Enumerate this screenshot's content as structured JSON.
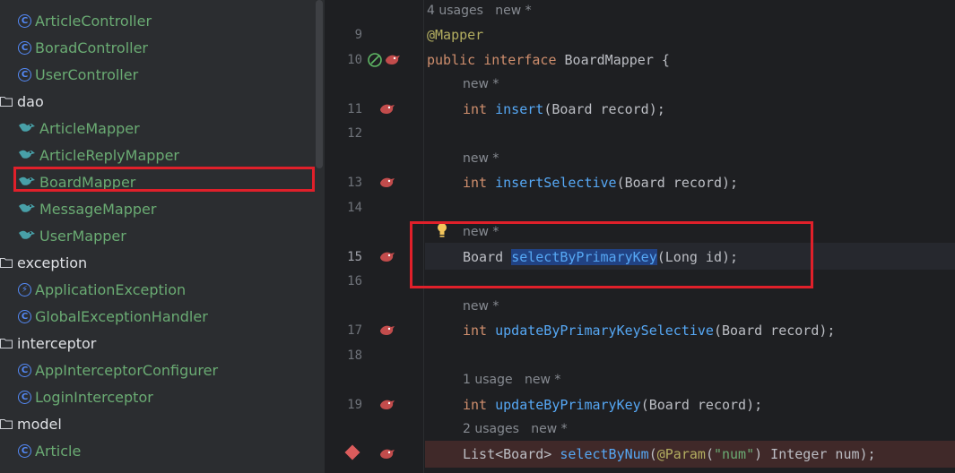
{
  "sidebar": {
    "items": [
      {
        "label": "ArticleController",
        "icon": "class-icon"
      },
      {
        "label": "BoradController",
        "icon": "class-icon"
      },
      {
        "label": "UserController",
        "icon": "class-icon"
      },
      {
        "label": "dao",
        "icon": "folder-icon"
      },
      {
        "label": "ArticleMapper",
        "icon": "mapper-icon"
      },
      {
        "label": "ArticleReplyMapper",
        "icon": "mapper-icon"
      },
      {
        "label": "BoardMapper",
        "icon": "mapper-icon",
        "selected": true
      },
      {
        "label": "MessageMapper",
        "icon": "mapper-icon"
      },
      {
        "label": "UserMapper",
        "icon": "mapper-icon"
      },
      {
        "label": "exception",
        "icon": "folder-icon"
      },
      {
        "label": "ApplicationException",
        "icon": "exception-class-icon"
      },
      {
        "label": "GlobalExceptionHandler",
        "icon": "class-icon"
      },
      {
        "label": "interceptor",
        "icon": "folder-icon"
      },
      {
        "label": "AppInterceptorConfigurer",
        "icon": "class-icon"
      },
      {
        "label": "LoginInterceptor",
        "icon": "class-icon"
      },
      {
        "label": "model",
        "icon": "folder-icon"
      },
      {
        "label": "Article",
        "icon": "class-icon"
      }
    ]
  },
  "editor": {
    "hints": {
      "iface_usages": "4 usages",
      "iface_new": "new *",
      "new": "new *",
      "one_usage": "1 usage",
      "two_usages": "2 usages"
    },
    "line_numbers": {
      "l9": "9",
      "l10": "10",
      "l11": "11",
      "l12": "12",
      "l13": "13",
      "l14": "14",
      "l15": "15",
      "l16": "16",
      "l17": "17",
      "l18": "18",
      "l19": "19"
    },
    "code": {
      "l9_annotation": "@Mapper",
      "l10_kw_public": "public",
      "l10_kw_interface": "interface",
      "l10_name": "BoardMapper {",
      "int": "int",
      "l11_fn": "insert",
      "l11_args": "(Board record);",
      "l13_fn": "insertSelective",
      "l13_args": "(Board record);",
      "l15_type": "Board",
      "l15_fn": "selectByPrimaryKey",
      "l15_args": "(Long id);",
      "l17_fn": "updateByPrimaryKeySelective",
      "l17_args": "(Board record);",
      "l19_fn": "updateByPrimaryKey",
      "l19_args": "(Board record);",
      "l20_type": "List<Board>",
      "l20_fn": "selectByNum",
      "l20_paren": "(",
      "l20_ann": "@Param",
      "l20_open": "(",
      "l20_str": "\"num\"",
      "l20_rest": ") Integer num);"
    }
  },
  "colors": {
    "highlight_box": "#e0202a",
    "keyword": "#cf8e6d",
    "function": "#56a8f5",
    "annotation": "#b3ae60",
    "class_label": "#6aab73"
  }
}
